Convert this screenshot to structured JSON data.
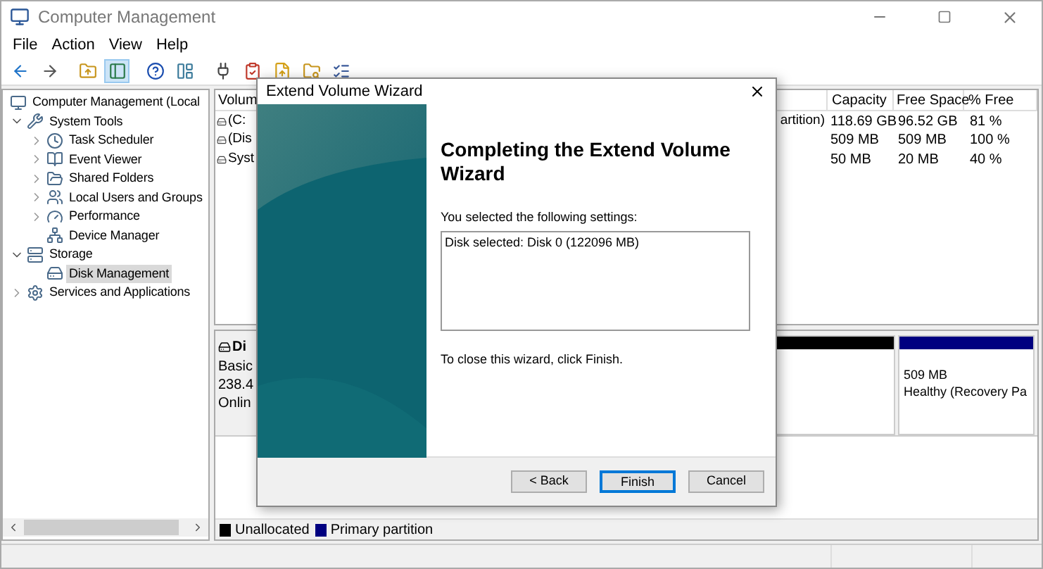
{
  "window": {
    "title": "Computer Management"
  },
  "menu": [
    "File",
    "Action",
    "View",
    "Help"
  ],
  "toolbar": [
    {
      "pressed": false
    },
    {
      "pressed": false
    },
    {
      "pressed": false
    },
    {
      "pressed": true
    },
    {
      "pressed": false
    },
    {
      "pressed": false
    },
    {
      "pressed": false
    },
    {
      "pressed": false
    },
    {
      "pressed": false
    },
    {
      "pressed": false
    },
    {
      "pressed": false
    }
  ],
  "tree": [
    {
      "label": "Computer Management (Local",
      "selected": false,
      "children": [
        {
          "label": "System Tools",
          "selected": false,
          "expanded": true,
          "children": [
            {
              "label": "Task Scheduler",
              "selected": false,
              "expanded": false
            },
            {
              "label": "Event Viewer",
              "selected": false,
              "expanded": false
            },
            {
              "label": "Shared Folders",
              "selected": false,
              "expanded": false
            },
            {
              "label": "Local Users and Groups",
              "selected": false,
              "expanded": false
            },
            {
              "label": "Performance",
              "selected": false,
              "expanded": false
            },
            {
              "label": "Device Manager",
              "selected": false
            }
          ]
        },
        {
          "label": "Storage",
          "selected": false,
          "expanded": true,
          "children": [
            {
              "label": "Disk Management",
              "selected": true
            }
          ]
        },
        {
          "label": "Services and Applications",
          "selected": false,
          "expanded": false
        }
      ]
    }
  ],
  "volumes": {
    "columns": [
      "Volum",
      "Capacity",
      "Free Space",
      "% Free"
    ],
    "rows": [
      {
        "volume": "(C:",
        "column_2": "artition)",
        "capacity": "118.69 GB",
        "free": "96.52 GB",
        "percent": "81 %"
      },
      {
        "volume": "(Dis",
        "capacity": "509 MB",
        "free": "509 MB",
        "percent": "100 %"
      },
      {
        "volume": "Syst",
        "capacity": "50 MB",
        "free": "20 MB",
        "percent": "40 %"
      }
    ]
  },
  "disk": {
    "name": "Di",
    "lines": [
      "Basic",
      "238.4",
      "Onlin"
    ],
    "partitions": [
      {
        "color": "#000000"
      },
      {
        "color": "#000080",
        "lines": [
          "509 MB",
          "Healthy (Recovery Pa"
        ]
      }
    ]
  },
  "legend": [
    {
      "label": "Unallocated",
      "color": "#000000"
    },
    {
      "label": "Primary partition",
      "color": "#000080"
    }
  ],
  "dialog": {
    "title": "Extend Volume Wizard",
    "heading": "Completing the Extend Volume Wizard",
    "settings_label": "You selected the following settings:",
    "settings_text": "Disk selected: Disk 0 (122096 MB)",
    "instruction": "To close this wizard, click Finish.",
    "buttons": [
      {
        "label": "< Back",
        "default": false
      },
      {
        "label": "Finish",
        "default": true
      },
      {
        "label": "Cancel",
        "default": false
      }
    ]
  }
}
